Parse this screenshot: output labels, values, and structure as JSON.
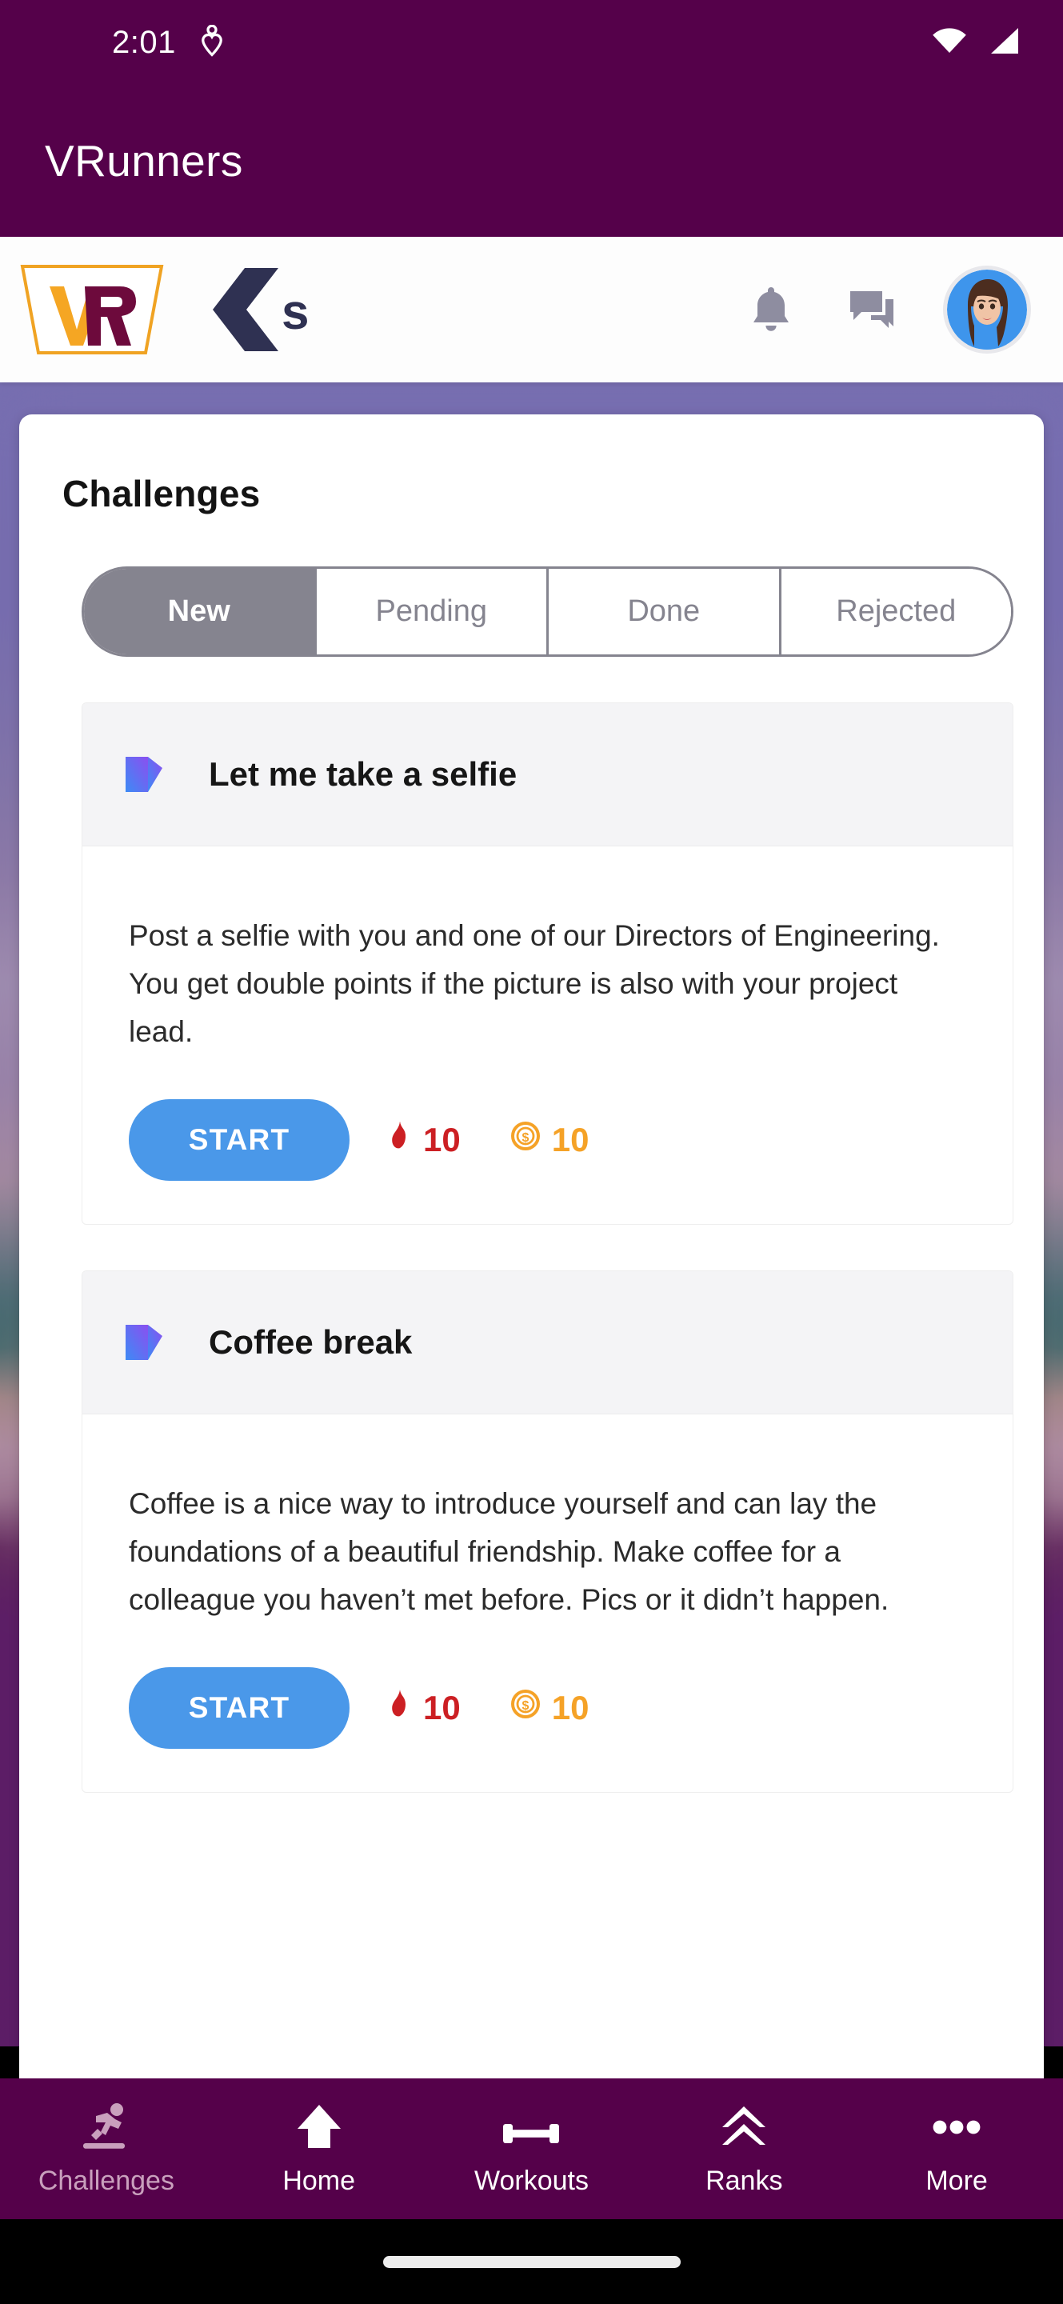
{
  "status_bar": {
    "clock": "2:01",
    "icons": [
      "location-heart-icon",
      "wifi-icon",
      "cell-signal-icon"
    ]
  },
  "app_bar": {
    "title": "VRunners"
  },
  "toolbar": {
    "brand_logo": "vrunners-logo-icon",
    "brand_logo_text": "VR",
    "partner_logo": "chevron-s-logo-icon",
    "partner_logo_text": "S",
    "notifications_icon": "bell-icon",
    "messages_icon": "chat-bubbles-icon",
    "avatar": "user-avatar"
  },
  "sheet": {
    "title": "Challenges",
    "tabs": [
      {
        "label": "New",
        "active": true
      },
      {
        "label": "Pending",
        "active": false
      },
      {
        "label": "Done",
        "active": false
      },
      {
        "label": "Rejected",
        "active": false
      }
    ],
    "challenges": [
      {
        "icon": "video-camera-icon",
        "title": "Let me take a selfie",
        "description": "Post a selfie with you and one of our Directors of Engineering. You get double points if the picture is also with your project lead.",
        "start_label": "START",
        "flame_icon": "flame-icon",
        "flame_points": "10",
        "coin_icon": "coin-icon",
        "coin_points": "10"
      },
      {
        "icon": "video-camera-icon",
        "title": "Coffee break",
        "description": "Coffee is a nice way to introduce yourself and can lay the foundations of a beautiful friendship. Make coffee for a colleague you haven’t met before. Pics or it didn’t happen.",
        "start_label": "START",
        "flame_icon": "flame-icon",
        "flame_points": "10",
        "coin_icon": "coin-icon",
        "coin_points": "10"
      }
    ]
  },
  "bottom_nav": [
    {
      "label": "Challenges",
      "icon": "running-treadmill-icon",
      "current": true
    },
    {
      "label": "Home",
      "icon": "house-icon",
      "current": false
    },
    {
      "label": "Workouts",
      "icon": "dumbbell-icon",
      "current": false
    },
    {
      "label": "Ranks",
      "icon": "double-chevron-up-icon",
      "current": false
    },
    {
      "label": "More",
      "icon": "ellipsis-icon",
      "current": false
    }
  ],
  "colors": {
    "brand_purple": "#55014a",
    "accent_blue": "#4a98e9",
    "segment_gray": "#85848f",
    "flame_red": "#cc1f23",
    "coin_orange": "#f5a227",
    "logo_orange": "#f0a323",
    "logo_maroon": "#6d0a3c",
    "partner_navy": "#2f3152",
    "nav_active_label": "#c9a0bd"
  }
}
